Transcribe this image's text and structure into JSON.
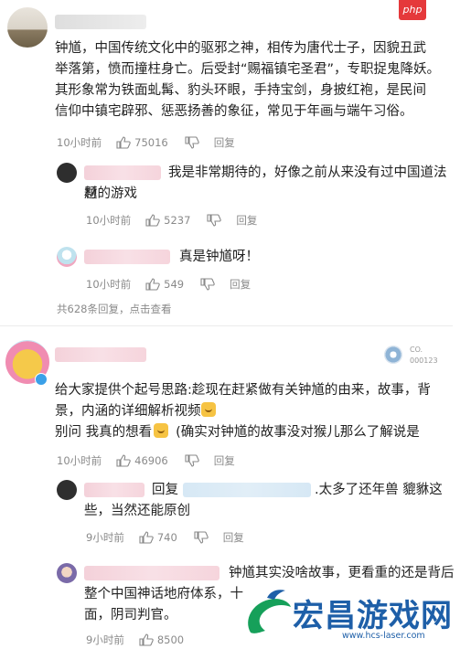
{
  "badge": "php",
  "watermark": {
    "name": "宏昌游戏网",
    "url": "www.hcs-laser.com"
  },
  "comment1": {
    "text_lines": [
      "钟馗，中国传统文化中的驱邪之神，相传为唐代士子，因貌丑武",
      "举落第，愤而撞柱身亡。后受封“赐福镇宅圣君”，专职捉鬼降妖。",
      "其形象常为铁面虬髯、豹头环眼，手持宝剑，身披红袍，是民间",
      "信仰中镇宅辟邪、惩恶扬善的象征，常见于年画与端午习俗。"
    ],
    "time": "10小时前",
    "likes": "75016",
    "reply": "回复",
    "replies": [
      {
        "lines": [
          "我是非常期待的，好像之前从来没有过中国道法题",
          "材的游戏"
        ],
        "time": "10小时前",
        "likes": "5237",
        "reply": "回复"
      },
      {
        "lines": [
          "真是钟馗呀！"
        ],
        "time": "10小时前",
        "likes": "549",
        "reply": "回复"
      }
    ],
    "more": "共628条回复，点击查看"
  },
  "comment2": {
    "badge_small": "CO.",
    "badge_code": "000123",
    "text_lines": [
      "给大家提供个起号思路:趁现在赶紧做有关钟馗的由来，故事，背",
      "景，内涵的详细解析视频",
      "别问 我真的想看",
      "(确实对钟馗的故事没对猴儿那么了解说是"
    ],
    "time": "10小时前",
    "likes": "46906",
    "reply": "回复",
    "replies": [
      {
        "prefix": "回复",
        "lines": [
          ".太多了还年兽 貔貅这",
          "些，当然还能原创"
        ],
        "time": "9小时前",
        "likes": "740",
        "reply": "回复"
      },
      {
        "lines": [
          "钟馗其实没啥故事，更看重的还是背后",
          "整个中国神话地府体系，十",
          "面，阴司判官。"
        ],
        "time": "9小时前",
        "likes": "8500"
      }
    ]
  }
}
